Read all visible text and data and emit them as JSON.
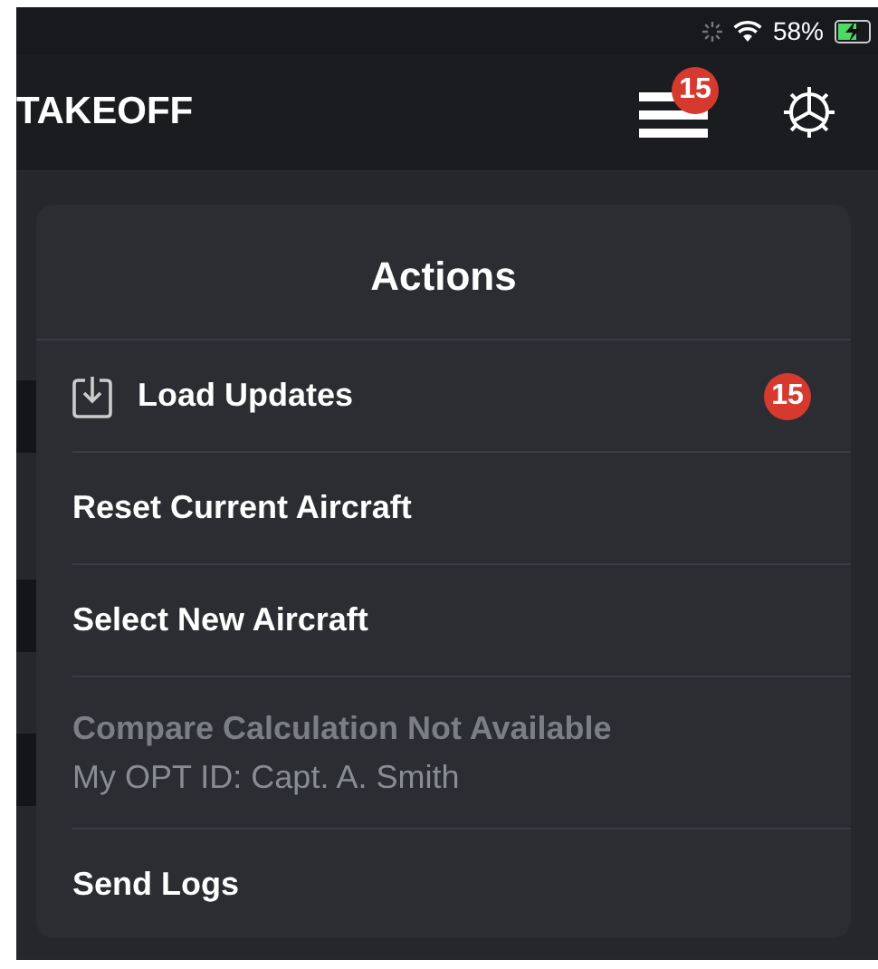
{
  "status_bar": {
    "battery": "58%",
    "charging": true
  },
  "nav_bar": {
    "title": "TAKEOFF",
    "menu_badge": "15"
  },
  "popover": {
    "title": "Actions",
    "items": [
      {
        "label": "Load Updates",
        "kind": "download",
        "badge": "15",
        "disabled": false
      },
      {
        "label": "Reset Current Aircraft",
        "kind": "plain",
        "disabled": false
      },
      {
        "label": "Select New Aircraft",
        "kind": "plain",
        "disabled": false
      },
      {
        "label": "Compare Calculation Not Available",
        "subtitle": "My OPT ID: Capt. A. Smith",
        "kind": "plain",
        "disabled": true
      },
      {
        "label": "Send Logs",
        "kind": "plain",
        "disabled": false
      }
    ]
  }
}
